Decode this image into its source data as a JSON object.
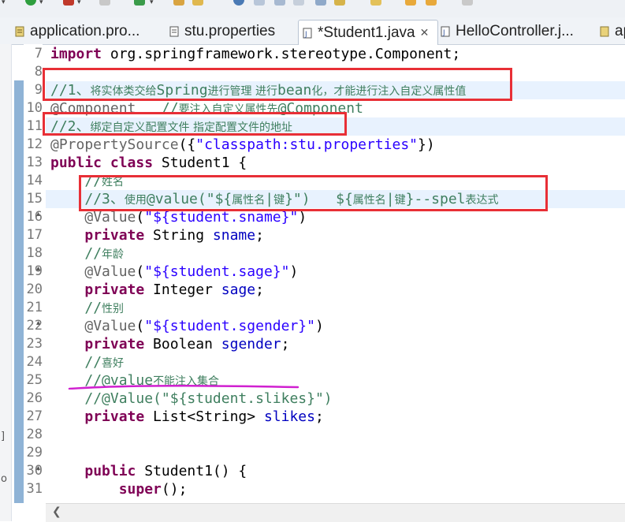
{
  "tabs": [
    {
      "label": "application.pro...",
      "icon": "properties-file-icon",
      "active": false
    },
    {
      "label": "stu.properties",
      "icon": "properties-file-icon",
      "active": false
    },
    {
      "label": "*Student1.java",
      "icon": "java-file-icon",
      "active": true,
      "close": "✕"
    },
    {
      "label": "HelloController.j...",
      "icon": "java-file-icon",
      "active": false
    },
    {
      "label": "ap",
      "icon": "properties-file-icon",
      "active": false
    }
  ],
  "line_numbers": [
    "7",
    "8",
    "9",
    "10",
    "11",
    "12",
    "13",
    "14",
    "15",
    "16",
    "17",
    "18",
    "19",
    "20",
    "21",
    "22",
    "23",
    "24",
    "25",
    "26",
    "27",
    "28",
    "29",
    "30",
    "31"
  ],
  "code": {
    "l7": {
      "kw": "import",
      "rest": " org.springframework.stereotype.Component;"
    },
    "l9": {
      "slash": "//1、",
      "cn1": "将实体类交给",
      "en1": "Spring",
      "cn2": "进行管理 进行",
      "en2": "bean",
      "cn3": "化，才能进行注入自定义属性值"
    },
    "l10": {
      "ann": "@Component",
      "cm": "   //",
      "cn": "要注入自定义属性先",
      "cm2": "@Component"
    },
    "l11": {
      "slash": "//2、",
      "cn": "绑定自定义配置文件 指定配置文件的地址"
    },
    "l12": {
      "ann": "@PropertySource",
      "p1": "({",
      "str": "\"classpath:stu.properties\"",
      "p2": "})"
    },
    "l13": {
      "kw1": "public",
      "kw2": "class",
      "rest": " Student1 {"
    },
    "l14": {
      "slash": "//",
      "cn": "姓名"
    },
    "l15": {
      "slash": "//3、",
      "cn1": "使用",
      "en1": "@value(\"${",
      "cn2": "属性名",
      "en2": "|",
      "cn3": "键",
      "en3": "}\")   ${",
      "cn4": "属性名",
      "en4": "|",
      "cn5": "键",
      "en5": "}--spel",
      "cn6": "表达式"
    },
    "l16": {
      "ann": "@Value",
      "p1": "(",
      "str": "\"${student.sname}\"",
      "p2": ")"
    },
    "l17": {
      "kw": "private",
      "type": " String ",
      "fld": "sname",
      "end": ";"
    },
    "l18": {
      "slash": "//",
      "cn": "年龄"
    },
    "l19": {
      "ann": "@Value",
      "p1": "(",
      "str": "\"${student.sage}\"",
      "p2": ")"
    },
    "l20": {
      "kw": "private",
      "type": " Integer ",
      "fld": "sage",
      "end": ";"
    },
    "l21": {
      "slash": "//",
      "cn": "性别"
    },
    "l22": {
      "ann": "@Value",
      "p1": "(",
      "str": "\"${student.sgender}\"",
      "p2": ")"
    },
    "l23": {
      "kw": "private",
      "type": " Boolean ",
      "fld": "sgender",
      "end": ";"
    },
    "l24": {
      "slash": "//",
      "cn": "喜好"
    },
    "l25": {
      "slash": "//@value",
      "cn": "不能注入集合"
    },
    "l26": {
      "cm": "//@Value(\"${student.slikes}\")"
    },
    "l27": {
      "kw": "private",
      "type": " List<String> ",
      "fld": "slikes",
      "end": ";"
    },
    "l30": {
      "kw": "public",
      "rest": " Student1() {"
    },
    "l31": {
      "kw": "super",
      "rest": "();"
    }
  },
  "colors": {
    "keyword": "#7f0055",
    "comment": "#3f7f5f",
    "string": "#2a00ff",
    "annotation": "#646464",
    "field": "#0000c0",
    "highlight_box": "#e82f36",
    "underline": "#d020d0"
  }
}
